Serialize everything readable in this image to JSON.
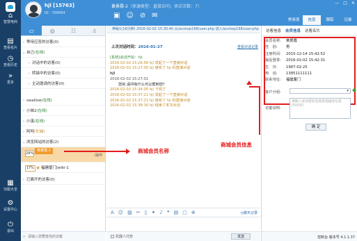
{
  "sidebar": {
    "items": [
      {
        "label": "智慧电商",
        "icon": "shop-icon"
      },
      {
        "label": "查看名片",
        "icon": "card-icon"
      },
      {
        "label": "查看历史",
        "icon": "history-icon"
      },
      {
        "label": "更多",
        "icon": "more-icon"
      },
      {
        "label": "功能大全",
        "icon": "grid-icon"
      },
      {
        "label": "设置中心",
        "icon": "gear-icon"
      },
      {
        "label": "退出",
        "icon": "power-icon"
      }
    ]
  },
  "header": {
    "username": "hjl [15763]",
    "userid": "ID：759564",
    "visitor_name": "黄景霞-2",
    "visitor_meta": "（来源类型：直接访问；来访次数：7）",
    "tabs": [
      "常用语",
      "信息",
      "跟踪",
      "记录"
    ],
    "active_tab": "信息"
  },
  "visitor_list": {
    "tabs": [
      "chat-bubble-icon",
      "globe-icon",
      "people-icon",
      "person-icon"
    ],
    "groups": [
      {
        "label": "等待应答的访客(0)",
        "indent": 0
      },
      {
        "label": "自己",
        "status": "(在线)",
        "indent": 0
      },
      {
        "label": "对话中的访客(0)",
        "indent": 1
      },
      {
        "label": "转接中的访客(0)",
        "indent": 1
      },
      {
        "label": "主动邀请的访客(0)",
        "indent": 1
      },
      {
        "label": "swallow",
        "status": "(在线)",
        "indent": 0
      },
      {
        "label": "小妹2",
        "status": "(在线)",
        "indent": 0
      },
      {
        "label": "小溪",
        "status": "(在线)",
        "indent": 0
      },
      {
        "label": "阿呵",
        "status": "(忙碌)",
        "indent": 0
      },
      {
        "label": "浏览网站的访客(2)",
        "indent": 0
      }
    ],
    "selected_visitor": {
      "percent": "29%",
      "name": "黄景霞-2",
      "action": "操作"
    },
    "second_visitor": {
      "percent": "17%",
      "name": "福建厦门|wiki-1"
    },
    "closed_group": "已离开的访客(0)",
    "search_placeholder": "请输入您要查找的访客"
  },
  "conversation": {
    "url_line": "神秘1(18分钟) 2016-02-02 15:30:40 从/ecshop198/user.php 进入/ecshop198/user.php",
    "last_visit_label": "上次对话时间：",
    "last_visit_date": "2016-01-27",
    "view_record": "查看对话记录",
    "messages": [
      {
        "type": "svc",
        "text": "[系统]会话开始：hjl"
      },
      {
        "type": "sys",
        "text": "2016-02-02 15:26:58 hjl 发起了一个直接对话"
      },
      {
        "type": "sys",
        "text": "2016-02-02 15:27:00 hjl 接受了 hjl 的直接对话"
      },
      {
        "type": "user",
        "text": "hjl"
      },
      {
        "type": "user",
        "text": "2016-02-02 15:27:01"
      },
      {
        "type": "user",
        "text": "您好,请问有什么可以帮到您?"
      },
      {
        "type": "sys",
        "text": "2016-02-02 15:34:00 hjl 下线了"
      },
      {
        "type": "sys",
        "text": "2016-02-02 15:37:21 hjl 发起了一个直接对话"
      },
      {
        "type": "sys",
        "text": "2016-02-02 15:37:21 hjl 接受了 hjl 的直接对话"
      },
      {
        "type": "sys",
        "text": "2016-02-02 15:38:16 hjl 结束了本次对话"
      }
    ],
    "tools": [
      "font-icon",
      "emoji-icon",
      "image-icon",
      "screenshot-icon",
      "file-icon",
      "shake-icon",
      "mic-icon",
      "quote-icon",
      "note-icon",
      "ticket-icon",
      "stop-icon"
    ],
    "history_link": "聊天记录",
    "robot_label": "机器人托管",
    "send_label": "发送"
  },
  "info": {
    "tabs": [
      "访客信息",
      "会员信息",
      "访客名片"
    ],
    "active_tab": "会员信息",
    "fields": [
      {
        "label": "会员名称:",
        "value": "黄景霞"
      },
      {
        "label": "性　别:",
        "value": "男"
      },
      {
        "label": "注册时间:",
        "value": "2015-12-14 15:42:52"
      },
      {
        "label": "最后登录:",
        "value": "2016-02-02 15:42:31"
      },
      {
        "label": "生　日:",
        "value": "1987-02-25"
      },
      {
        "label": "电　话:",
        "value": "13851111111"
      },
      {
        "label": "联系地址:",
        "value": "福建厦门"
      }
    ],
    "attr_label": "客户分组:",
    "remark_label": "访客说明:",
    "remark_placeholder": "请输入该访客标签等其他描述信息(500字)",
    "ok_label": "确 定",
    "version": "控制台 版本号 4.1.1.37"
  },
  "annotations": {
    "member_name": "商城会员名称",
    "member_info": "商城会员信息"
  },
  "colors": {
    "header": "#3e8fd6",
    "sidebar": "#1a3f66",
    "annotation": "#e31b1b"
  }
}
